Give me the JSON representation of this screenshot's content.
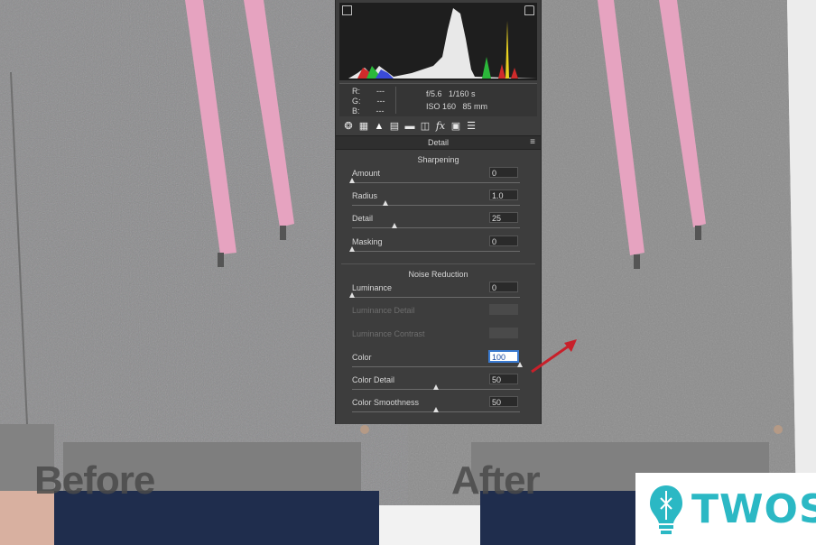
{
  "captions": {
    "before": "Before",
    "after": "After"
  },
  "panel": {
    "readout": {
      "r_label": "R:",
      "r_value": "---",
      "g_label": "G:",
      "g_value": "---",
      "b_label": "B:",
      "b_value": "---",
      "aperture": "f/5.6",
      "shutter": "1/160 s",
      "iso": "ISO 160",
      "focal": "85 mm"
    },
    "tools": [
      "camera-icon",
      "grid-icon",
      "mountain-icon",
      "split-icon",
      "hsl-icon",
      "lens-icon",
      "fx-icon",
      "calibration-icon",
      "presets-icon"
    ],
    "section_title": "Detail",
    "sharpening": {
      "title": "Sharpening",
      "amount": {
        "label": "Amount",
        "value": "0",
        "level": 0.0
      },
      "radius": {
        "label": "Radius",
        "value": "1.0",
        "level": 0.2
      },
      "detail": {
        "label": "Detail",
        "value": "25",
        "level": 0.25
      },
      "masking": {
        "label": "Masking",
        "value": "0",
        "level": 0.0
      }
    },
    "noise_reduction": {
      "title": "Noise Reduction",
      "luminance": {
        "label": "Luminance",
        "value": "0",
        "level": 0.0
      },
      "luminance_detail": {
        "label": "Luminance Detail",
        "value": ""
      },
      "luminance_contrast": {
        "label": "Luminance Contrast",
        "value": ""
      },
      "color": {
        "label": "Color",
        "value": "100",
        "level": 1.0
      },
      "color_detail": {
        "label": "Color Detail",
        "value": "50",
        "level": 0.5
      },
      "color_smoothness": {
        "label": "Color Smoothness",
        "value": "50",
        "level": 0.5
      }
    }
  },
  "logo": {
    "text": "TWOS"
  },
  "colors": {
    "accent_arrow": "#c8202a",
    "logo_teal": "#2bb8c4",
    "panel_bg": "#3d3d3d"
  }
}
